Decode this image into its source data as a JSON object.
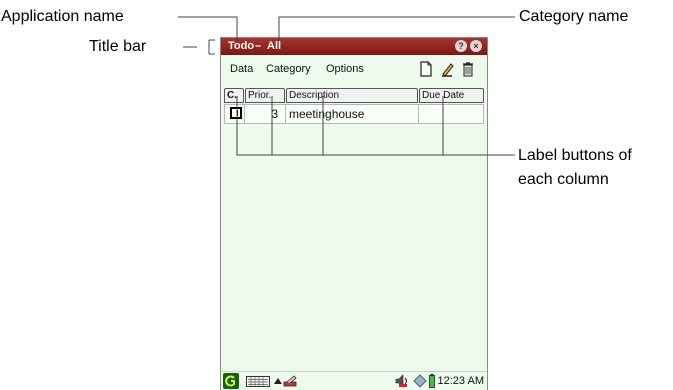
{
  "callouts": {
    "application_name": "Application name",
    "title_bar": "Title bar",
    "category_name": "Category name",
    "label_buttons_line1": "Label buttons of",
    "label_buttons_line2": "each column"
  },
  "titlebar": {
    "app_name": "Todo",
    "separator": "–",
    "category": "All",
    "help_icon": "?",
    "close_icon": "×"
  },
  "menubar": {
    "items": [
      "Data",
      "Category",
      "Options"
    ],
    "tools": [
      "new-document-icon",
      "edit-pencil-icon",
      "trash-icon"
    ]
  },
  "table": {
    "columns": [
      "C.",
      "Prior.",
      "Description",
      "Due Date"
    ],
    "rows": [
      {
        "completed": false,
        "priority": "3",
        "description": "meetinghouse",
        "due_date": ""
      }
    ]
  },
  "taskbar": {
    "icons": [
      "start-icon",
      "keyboard-icon",
      "up-arrow-icon",
      "input-method-icon",
      "speaker-icon",
      "network-icon",
      "battery-icon"
    ],
    "time": "12:23 AM"
  },
  "colors": {
    "titlebar": "#8b1f19",
    "background": "#eefaee"
  }
}
